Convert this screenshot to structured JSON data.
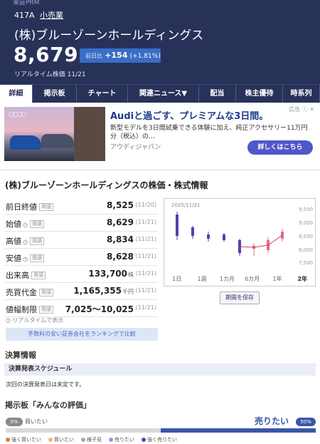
{
  "header": {
    "market": "東証PRM",
    "code": "417A",
    "sector": "小売業",
    "company": "(株)ブルーゾーンホールディングス",
    "price": "8,679",
    "change_label": "前日比",
    "change_value": "+154",
    "change_pct": "(+1.81%)",
    "rt_label": "リアルタイム株価",
    "rt_date": "11/21"
  },
  "tabs": [
    {
      "label": "詳細"
    },
    {
      "label": "掲示板"
    },
    {
      "label": "チャート"
    },
    {
      "label": "関連ニュース▼"
    },
    {
      "label": "配当"
    },
    {
      "label": "株主優待"
    },
    {
      "label": "時系列"
    }
  ],
  "ad": {
    "title": "Audiと過ごす、プレミアムな3日間。",
    "desc": "新型モデルを3日間試乗できる体験に加え、純正アクセサリー11万円分（税込）の…",
    "advertiser": "アウディジャパン",
    "cta": "詳しくはこちら",
    "mark": "広告 ⓘ ✕",
    "logo": "○○○○"
  },
  "stock": {
    "title": "(株)ブルーゾーンホールディングスの株価・株式情報",
    "yogo": "用語",
    "rows": [
      {
        "label": "前日終値",
        "value": "8,525",
        "unit": "",
        "date": "(11/20)"
      },
      {
        "label": "始値",
        "value": "8,629",
        "unit": "",
        "date": "(11/21)"
      },
      {
        "label": "高値",
        "value": "8,834",
        "unit": "",
        "date": "(11/21)"
      },
      {
        "label": "安値",
        "value": "8,628",
        "unit": "",
        "date": "(11/21)"
      },
      {
        "label": "出来高",
        "value": "133,700",
        "unit": "株",
        "date": "(11/21)"
      },
      {
        "label": "売買代金",
        "value": "1,165,355",
        "unit": "千円",
        "date": "(11/21)"
      },
      {
        "label": "値幅制限",
        "value": "7,025〜10,025",
        "unit": "",
        "date": "(11/21)"
      }
    ],
    "rt_note": "リアルタイムで表示",
    "rank_btn": "手数料の安い証券会社をランキングで比較"
  },
  "chart": {
    "date": "2025/11/21",
    "yticks": [
      "9,500",
      "9,000",
      "8,500",
      "8,000",
      "7,500"
    ],
    "periods": [
      "1日",
      "1週",
      "1カ月",
      "6カ月",
      "1年",
      "2年"
    ],
    "active_period": "2年",
    "save": "期間を保存",
    "colors": {
      "down": "#5b3bb1",
      "up": "#e06b86",
      "line": "#d63b5c"
    }
  },
  "kessan": {
    "title": "決算情報",
    "schedule": "決算発表スケジュール",
    "note": "次回の決算発表日は未定です。"
  },
  "board": {
    "title": "掲示板「みんなの評価」",
    "buy_pct": "0%",
    "buy_label": "買いたい",
    "sell_label": "売りたい",
    "sell_pct": "50%",
    "sell_ratio": 0.5,
    "legend": [
      {
        "label": "強く買いたい",
        "color": "#e07b3a"
      },
      {
        "label": "買いたい",
        "color": "#f0b37a"
      },
      {
        "label": "様子見",
        "color": "#aaaaaa"
      },
      {
        "label": "売りたい",
        "color": "#8aa0d6"
      },
      {
        "label": "強く売りたい",
        "color": "#3a56a8"
      }
    ]
  }
}
